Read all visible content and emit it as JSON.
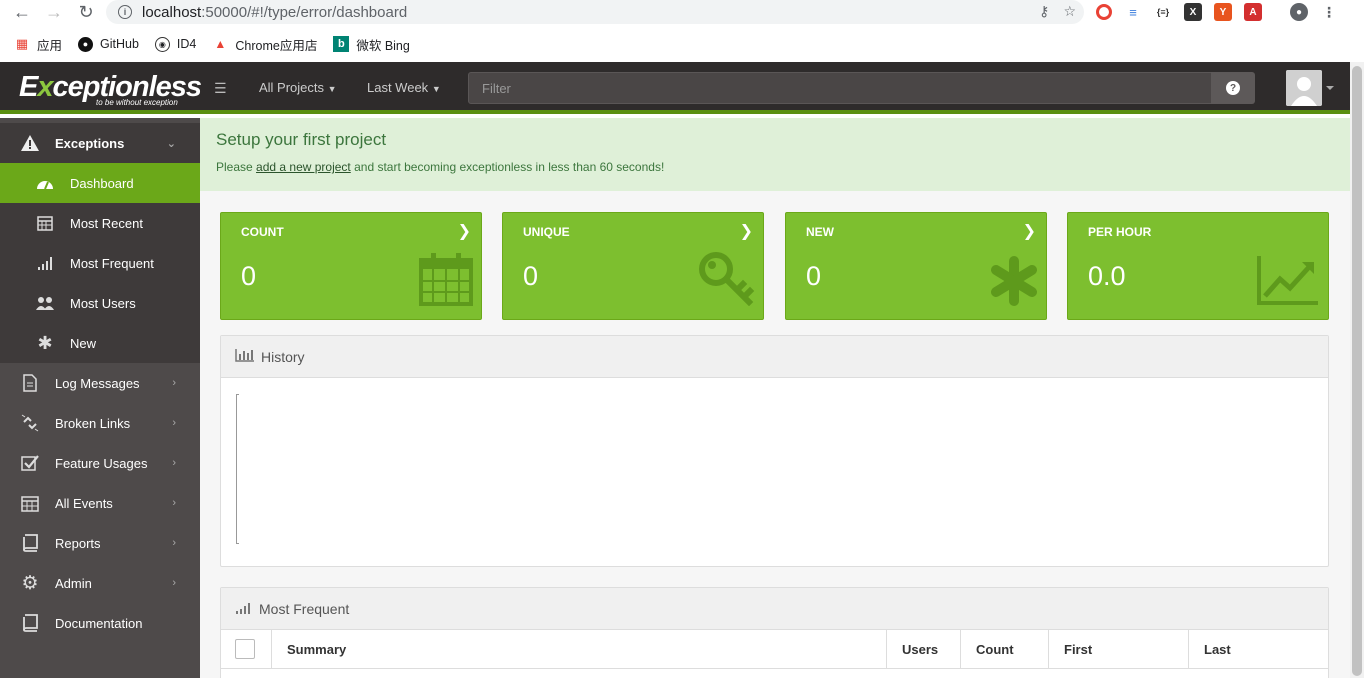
{
  "browser": {
    "url_host": "localhost",
    "url_rest": ":50000/#!/type/error/dashboard",
    "bookmarks": [
      {
        "label": "应用"
      },
      {
        "label": "GitHub"
      },
      {
        "label": "ID4"
      },
      {
        "label": "Chrome应用店"
      },
      {
        "label": "微软 Bing"
      }
    ]
  },
  "topbar": {
    "logo_main": "ceptionless",
    "logo_e": "E",
    "logo_x": "x",
    "logo_tagline": "to be without exception",
    "projects_label": "All Projects",
    "timeframe_label": "Last Week",
    "filter_placeholder": "Filter",
    "help_label": "?"
  },
  "sidebar": {
    "items": [
      {
        "label": "Exceptions",
        "icon": "warning-icon"
      },
      {
        "label": "Dashboard",
        "icon": "dashboard-icon"
      },
      {
        "label": "Most Recent",
        "icon": "calendar-icon"
      },
      {
        "label": "Most Frequent",
        "icon": "signal-icon"
      },
      {
        "label": "Most Users",
        "icon": "users-icon"
      },
      {
        "label": "New",
        "icon": "asterisk-icon"
      },
      {
        "label": "Log Messages",
        "icon": "file-icon"
      },
      {
        "label": "Broken Links",
        "icon": "unlink-icon"
      },
      {
        "label": "Feature Usages",
        "icon": "check-square-icon"
      },
      {
        "label": "All Events",
        "icon": "calendar-icon"
      },
      {
        "label": "Reports",
        "icon": "book-icon"
      },
      {
        "label": "Admin",
        "icon": "gear-icon"
      },
      {
        "label": "Documentation",
        "icon": "book-icon"
      }
    ]
  },
  "setup": {
    "title": "Setup your first project",
    "text_before": "Please ",
    "link": "add a new project",
    "text_after": " and start becoming exceptionless in less than 60 seconds!"
  },
  "stats": [
    {
      "label": "COUNT",
      "value": "0",
      "icon": "calendar-icon"
    },
    {
      "label": "UNIQUE",
      "value": "0",
      "icon": "key-icon"
    },
    {
      "label": "NEW",
      "value": "0",
      "icon": "asterisk-icon"
    },
    {
      "label": "PER HOUR",
      "value": "0.0",
      "icon": "line-chart-icon"
    }
  ],
  "history": {
    "title": "History"
  },
  "most_frequent": {
    "title": "Most Frequent",
    "columns": [
      "Summary",
      "Users",
      "Count",
      "First",
      "Last"
    ]
  },
  "colors": {
    "accent": "#7dbf2f",
    "active": "#6ba819",
    "sidebar": "#4e4a4a",
    "topbar": "#2e2b2b"
  }
}
